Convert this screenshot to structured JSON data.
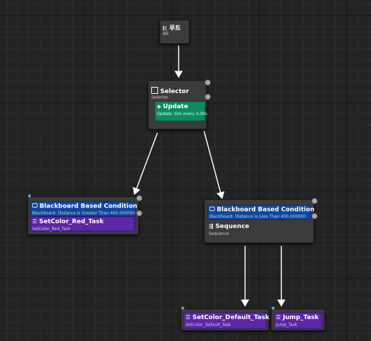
{
  "root": {
    "title": "루트",
    "subtitle": "BB"
  },
  "selector": {
    "title": "Selector",
    "subtitle": "Selector"
  },
  "update_service": {
    "title": "Update",
    "subtitle": "Update: tick every 0.00s"
  },
  "left_branch": {
    "decorator_title": "Blackboard Based Condition",
    "decorator_subtitle": "Blackboard: Distance is Greater Than 400.000000",
    "task_title": "SetColor_Red_Task",
    "task_subtitle": "SetColor_Red_Task"
  },
  "right_branch": {
    "decorator_title": "Blackboard Based Condition",
    "decorator_subtitle": "Blackboard: Distance is Less Than 400.000000",
    "composite_title": "Sequence",
    "composite_subtitle": "Sequence"
  },
  "task_default": {
    "title": "SetColor_Default_Task",
    "subtitle": "SetColor_Default_Task"
  },
  "task_jump": {
    "title": "Jump_Task",
    "subtitle": "Jump_Task"
  },
  "colors": {
    "decorator": "#10479e",
    "task": "#5a27a6",
    "service": "#0d8a62",
    "wire": "#ffffff",
    "background": "#232323"
  }
}
